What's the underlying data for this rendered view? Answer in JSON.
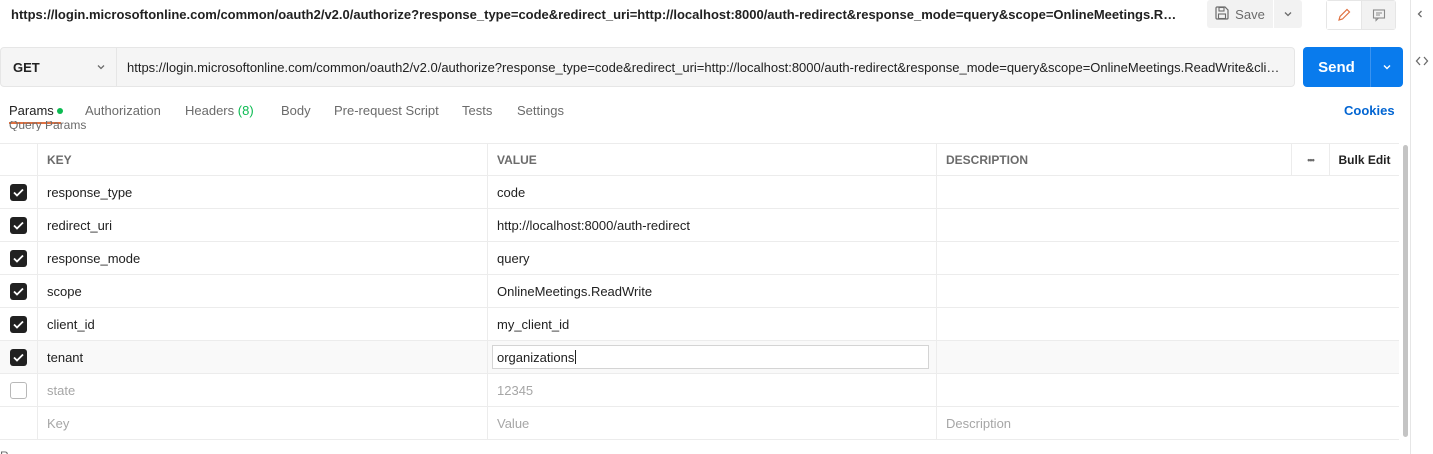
{
  "header": {
    "request_title": "https://login.microsoftonline.com/common/oauth2/v2.0/authorize?response_type=code&redirect_uri=http://localhost:8000/auth-redirect&response_mode=query&scope=OnlineMeetings.ReadWrite...",
    "save_label": "Save"
  },
  "request": {
    "method": "GET",
    "url": "https://login.microsoftonline.com/common/oauth2/v2.0/authorize?response_type=code&redirect_uri=http://localhost:8000/auth-redirect&response_mode=query&scope=OnlineMeetings.ReadWrite&clien...",
    "send_label": "Send"
  },
  "tabs": [
    {
      "label": "Params",
      "active": true,
      "dot": true
    },
    {
      "label": "Authorization"
    },
    {
      "label": "Headers",
      "count": "(8)"
    },
    {
      "label": "Body"
    },
    {
      "label": "Pre-request Script"
    },
    {
      "label": "Tests"
    },
    {
      "label": "Settings"
    }
  ],
  "cookies_label": "Cookies",
  "query_params_label": "Query Params",
  "table": {
    "headers": {
      "key": "KEY",
      "value": "VALUE",
      "description": "DESCRIPTION",
      "more": "•••",
      "bulk_edit": "Bulk Edit"
    },
    "rows": [
      {
        "checked": true,
        "key": "response_type",
        "value": "code",
        "description": ""
      },
      {
        "checked": true,
        "key": "redirect_uri",
        "value": "http://localhost:8000/auth-redirect",
        "description": ""
      },
      {
        "checked": true,
        "key": "response_mode",
        "value": "query",
        "description": ""
      },
      {
        "checked": true,
        "key": "scope",
        "value": "OnlineMeetings.ReadWrite",
        "description": ""
      },
      {
        "checked": true,
        "key": "client_id",
        "value": "my_client_id",
        "description": ""
      },
      {
        "checked": true,
        "key": "tenant",
        "value": "organizations",
        "description": "",
        "editing": true
      },
      {
        "checked": false,
        "key": "state",
        "value": "12345",
        "description": ""
      }
    ],
    "placeholder": {
      "key": "Key",
      "value": "Value",
      "description": "Description"
    }
  },
  "bottom_peek": "R"
}
